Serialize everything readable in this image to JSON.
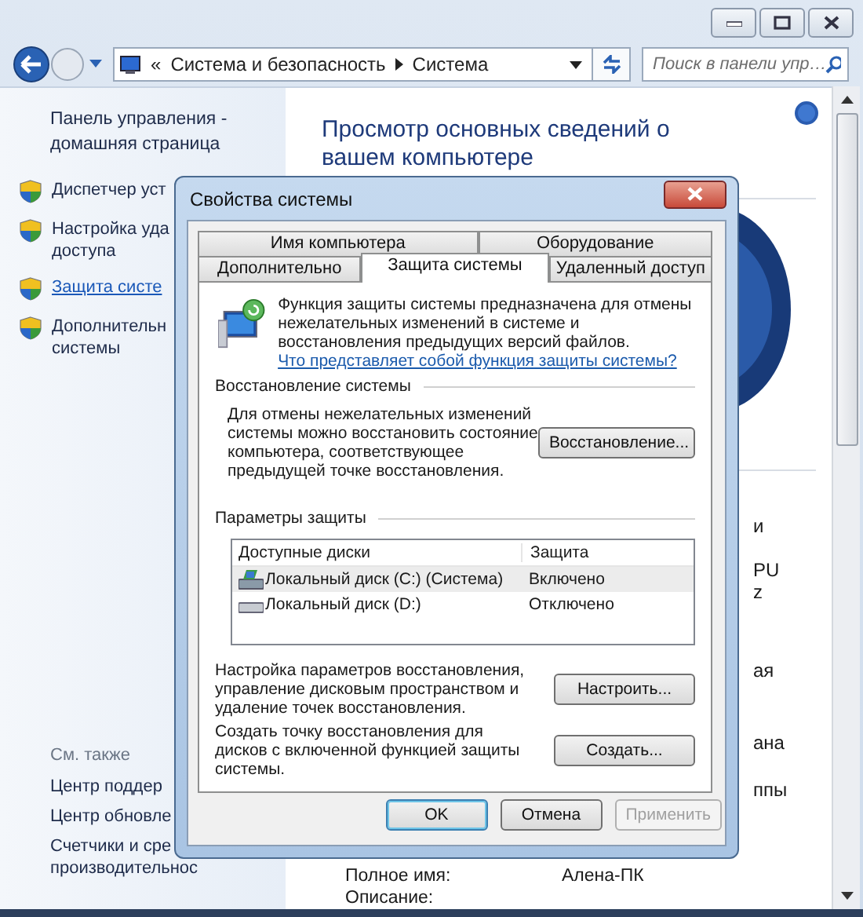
{
  "nav": {
    "overflow": "«",
    "breadcrumb": [
      "Система и безопасность",
      "Система"
    ],
    "search": {
      "placeholder": "Поиск в панели упр…"
    }
  },
  "sidebar": {
    "home_link": [
      "Панель управления -",
      "домашняя страница"
    ],
    "items": [
      {
        "lines": [
          "Диспетчер уст"
        ],
        "selected": false
      },
      {
        "lines": [
          "Настройка уда",
          "доступа"
        ],
        "selected": false
      },
      {
        "lines": [
          "Защита систе"
        ],
        "selected": true
      },
      {
        "lines": [
          "Дополнительн",
          "системы"
        ],
        "selected": false
      }
    ],
    "see_also": {
      "title": "См. также",
      "items": [
        {
          "lines": [
            "Центр поддер"
          ]
        },
        {
          "lines": [
            "Центр обновле"
          ]
        },
        {
          "lines": [
            "Счетчики и сре",
            "производительнос"
          ]
        }
      ]
    }
  },
  "content": {
    "heading": "Просмотр основных сведений о вашем компьютере",
    "fragments": [
      "и",
      "PU",
      "z",
      "ая",
      "ана",
      "ппы"
    ],
    "fields": [
      {
        "label": "Полное имя:",
        "value": "Алена-ПК"
      },
      {
        "label": "Описание:"
      }
    ]
  },
  "dialog": {
    "title": "Свойства системы",
    "tab_rows": [
      {
        "tabs": [
          {
            "label": "Имя компьютера",
            "selected": false
          },
          {
            "label": "Оборудование",
            "selected": false
          }
        ]
      },
      {
        "tabs": [
          {
            "label": "Дополнительно",
            "selected": false
          },
          {
            "label": "Защита системы",
            "selected": true
          },
          {
            "label": "Удаленный доступ",
            "selected": false
          }
        ]
      }
    ],
    "intro": "Функция защиты системы предназначена для отмены нежелательных изменений в системе и восстановления предыдущих версий файлов.",
    "intro_link": "Что представляет собой функция защиты системы?",
    "restore": {
      "title": "Восстановление системы",
      "text": "Для отмены нежелательных изменений системы можно восстановить состояние компьютера, соответствующее предыдущей точке восстановления.",
      "button": "Восстановление..."
    },
    "protection": {
      "title": "Параметры защиты",
      "columns": [
        "Доступные диски",
        "Защита"
      ],
      "rows": [
        {
          "name": "Локальный диск (C:) (Система)",
          "status": "Включено",
          "kind": "system",
          "selected": true
        },
        {
          "name": "Локальный диск (D:)",
          "status": "Отключено",
          "kind": "drive",
          "selected": false
        }
      ],
      "actions": [
        {
          "text": "Настройка параметров восстановления, управление дисковым пространством и удаление точек восстановления.",
          "button": "Настроить..."
        },
        {
          "text": "Создать точку восстановления для дисков с включенной функцией защиты системы.",
          "button": "Создать..."
        }
      ]
    },
    "buttons": [
      {
        "label": "OK",
        "kind": "default",
        "disabled": false
      },
      {
        "label": "Отмена",
        "kind": "normal",
        "disabled": false
      },
      {
        "label": "Применить",
        "kind": "normal",
        "disabled": true
      }
    ]
  }
}
